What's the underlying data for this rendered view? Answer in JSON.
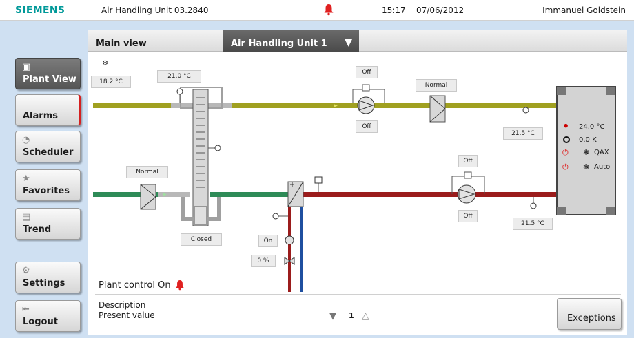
{
  "header": {
    "brand": "SIEMENS",
    "unit_title": "Air Handling Unit 03.2840",
    "time": "15:17",
    "date": "07/06/2012",
    "user": "Immanuel Goldstein"
  },
  "nav": {
    "items": [
      {
        "label": "Plant View",
        "icon": "plant-view-icon"
      },
      {
        "label": "Alarms",
        "icon": ""
      },
      {
        "label": "Scheduler",
        "icon": "scheduler-icon"
      },
      {
        "label": "Favorites",
        "icon": "star-icon"
      },
      {
        "label": "Trend",
        "icon": "trend-icon"
      },
      {
        "label": "Settings",
        "icon": "gear-icon"
      },
      {
        "label": "Logout",
        "icon": "logout-icon"
      }
    ]
  },
  "tabs": {
    "main": "Main view",
    "unit": "Air Handling Unit 1"
  },
  "diagram": {
    "outside_temp": "18.2 °C",
    "heat_exchanger_temp": "21.0 °C",
    "supply_fan_top_status": "Off",
    "supply_fan_bottom_status": "Off",
    "exhaust_damper_status": "Normal",
    "supply_temp_top": "21.5 °C",
    "room_temp": "24.0 °C",
    "room_setpoint_offset": "0.0 K",
    "fan_mode_1": "QAX",
    "fan_mode_2": "Auto",
    "inlet_damper_status": "Normal",
    "bypass_status": "Closed",
    "return_fan_top_status": "Off",
    "return_fan_bottom_status": "Off",
    "supply_temp_bottom": "21.5 °C",
    "pump_status": "On",
    "valve_position": "0 %"
  },
  "footer": {
    "plant_control": "Plant control On",
    "description": "Description",
    "present_value": "Present value",
    "page": "1",
    "exceptions": "Exceptions"
  },
  "colors": {
    "brand": "#009999",
    "supply_air_duct": "#a0a020",
    "outdoor_air_duct": "#2e8b57",
    "return_air_duct": "#9b1c1c",
    "alarm": "#e02020",
    "active_tab": "#555555"
  }
}
